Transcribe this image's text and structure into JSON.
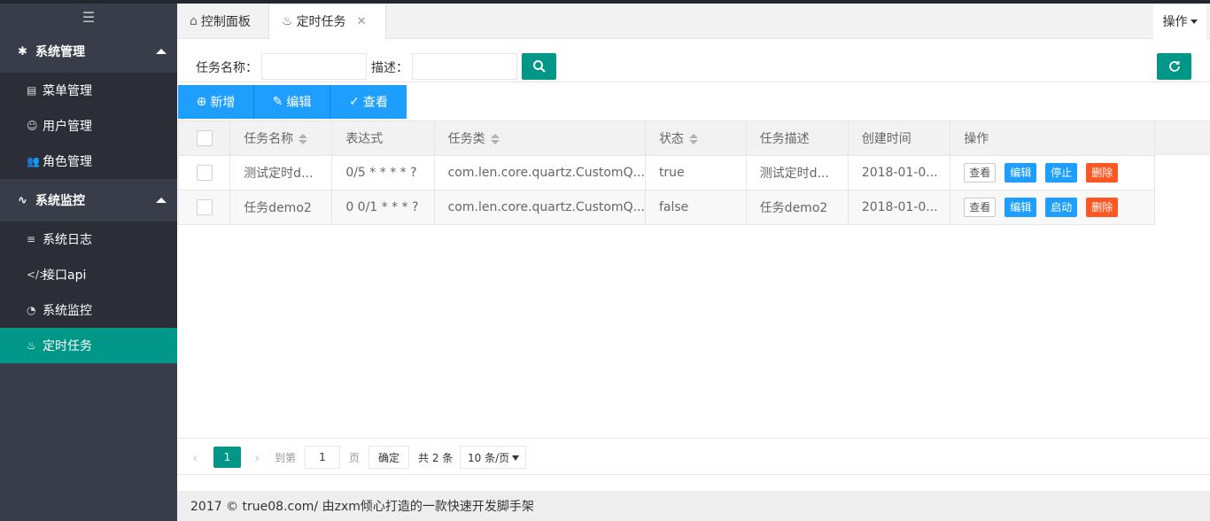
{
  "sidebar": {
    "groups": [
      {
        "label": "系统管理",
        "items": [
          {
            "label": "菜单管理"
          },
          {
            "label": "用户管理"
          },
          {
            "label": "角色管理"
          }
        ]
      },
      {
        "label": "系统监控",
        "items": [
          {
            "label": "系统日志"
          },
          {
            "label": "接口api"
          },
          {
            "label": "系统监控"
          },
          {
            "label": "定时任务"
          }
        ]
      }
    ]
  },
  "tabs": [
    {
      "label": "控制面板"
    },
    {
      "label": "定时任务"
    }
  ],
  "ops_label": "操作",
  "search": {
    "name_label": "任务名称：",
    "desc_label": "描述："
  },
  "toolbar": {
    "add": "新增",
    "edit": "编辑",
    "view": "查看"
  },
  "table": {
    "headers": [
      "任务名称",
      "表达式",
      "任务类",
      "状态",
      "任务描述",
      "创建时间",
      "操作"
    ],
    "rows": [
      {
        "name": "测试定时d...",
        "cron": "0/5 * * * * ?",
        "clazz": "com.len.core.quartz.CustomQ...",
        "status": "true",
        "desc": "测试定时d...",
        "created": "2018-01-0...",
        "actions": [
          "查看",
          "编辑",
          "停止",
          "删除"
        ]
      },
      {
        "name": "任务demo2",
        "cron": "0 0/1 * * * ?",
        "clazz": "com.len.core.quartz.CustomQ...",
        "status": "false",
        "desc": "任务demo2",
        "created": "2018-01-0...",
        "actions": [
          "查看",
          "编辑",
          "启动",
          "删除"
        ]
      }
    ]
  },
  "pager": {
    "current_page": "1",
    "goto_label": "到第",
    "goto_value": "1",
    "page_unit": "页",
    "confirm": "确定",
    "total": "共 2 条",
    "page_size": "10 条/页"
  },
  "footer": "2017 © true08.com/ 由zxm倾心打造的一款快速开发脚手架",
  "colors": {
    "sidebar_bg": "#393d49",
    "sidebar_sub_bg": "#2b2e37",
    "active_green": "#009688",
    "primary_blue": "#1e9fff",
    "danger_orange": "#ff5722"
  }
}
